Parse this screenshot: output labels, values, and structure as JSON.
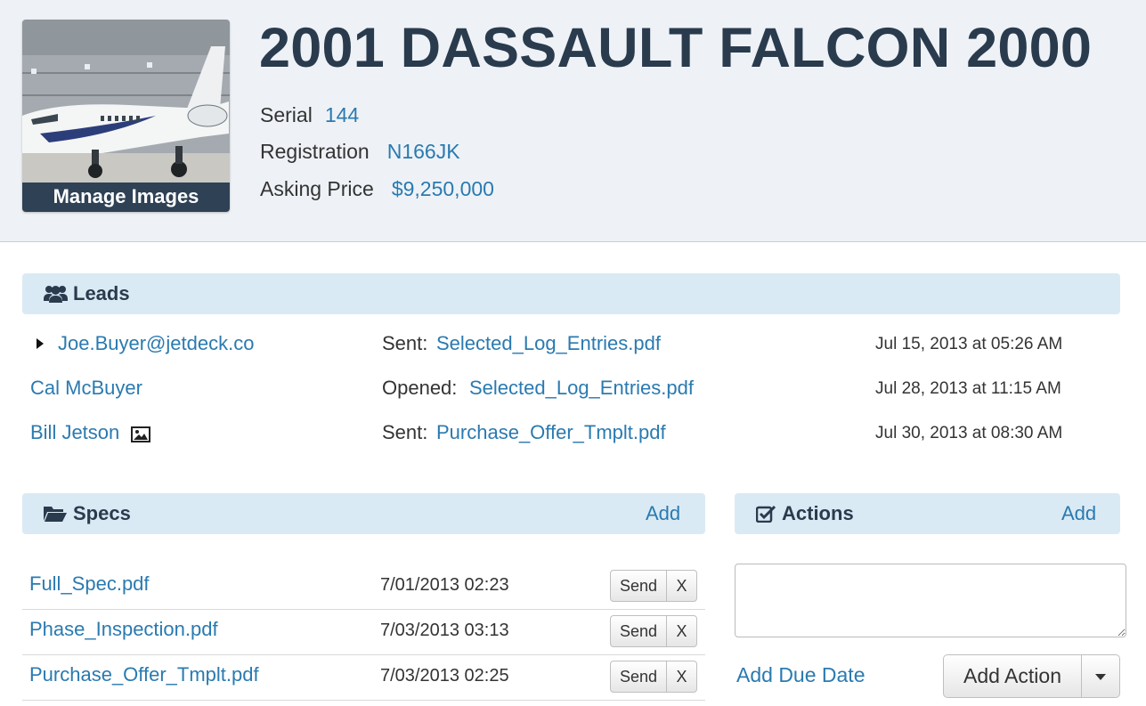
{
  "aircraft": {
    "title": "2001 DASSAULT FALCON 2000",
    "manage_images_label": "Manage Images",
    "serial_label": "Serial",
    "serial_value": "144",
    "registration_label": "Registration",
    "registration_value": "N166JK",
    "asking_price_label": "Asking Price",
    "asking_price_value": "$9,250,000"
  },
  "leads": {
    "title": "Leads",
    "icon": "users-icon",
    "rows": [
      {
        "name": "Joe.Buyer@jetdeck.co",
        "action": "Sent:",
        "file": "Selected_Log_Entries.pdf",
        "timestamp": "Jul 15, 2013 at 05:26 AM"
      },
      {
        "name": "Cal McBuyer",
        "action": "Opened:",
        "file": "Selected_Log_Entries.pdf",
        "timestamp": "Jul 28, 2013 at 11:15 AM"
      },
      {
        "name": "Bill Jetson",
        "action": "Sent:",
        "file": "Purchase_Offer_Tmplt.pdf",
        "timestamp": "Jul 30, 2013 at 08:30 AM"
      }
    ]
  },
  "specs": {
    "title": "Specs",
    "icon": "folder-open-icon",
    "add_label": "Add",
    "send_label": "Send",
    "remove_label": "X",
    "rows": [
      {
        "file": "Full_Spec.pdf",
        "date": "7/01/2013 02:23"
      },
      {
        "file": "Phase_Inspection.pdf",
        "date": "7/03/2013 03:13"
      },
      {
        "file": "Purchase_Offer_Tmplt.pdf",
        "date": "7/03/2013 02:25"
      }
    ]
  },
  "actions": {
    "title": "Actions",
    "icon": "check-square-icon",
    "add_label": "Add",
    "textarea_value": "",
    "add_due_date_label": "Add Due Date",
    "add_action_label": "Add Action"
  },
  "colors": {
    "header_bg": "#eef2f6",
    "section_bar_bg": "#daeaf4",
    "link": "#2a7ab0",
    "title": "#2a3b4e",
    "manage_images_bg": "#2e4155"
  }
}
